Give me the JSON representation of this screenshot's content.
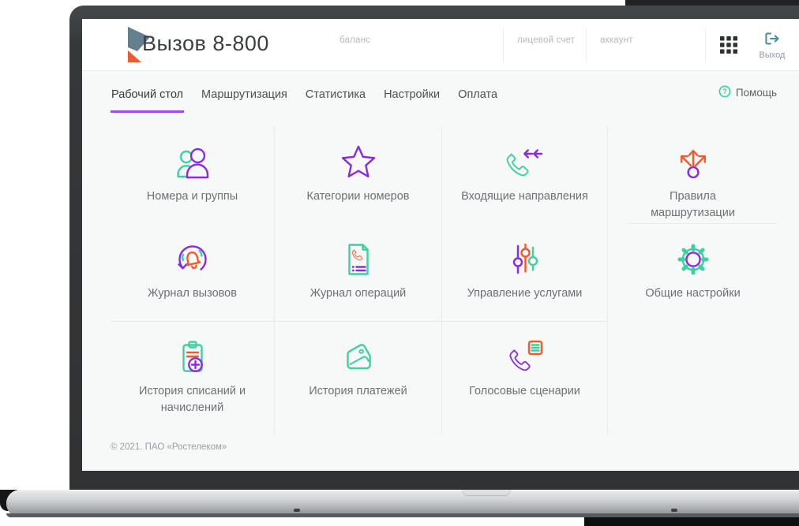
{
  "app": {
    "title": "Вызов 8-800"
  },
  "header": {
    "account_fields": [
      {
        "label": "баланс"
      },
      {
        "label": "лицевой счет"
      },
      {
        "label": "аккаунт"
      }
    ],
    "apps_icon": "apps-grid-icon",
    "logout": {
      "label": "Выход",
      "icon": "logout-icon"
    }
  },
  "nav": {
    "tabs": [
      {
        "label": "Рабочий стол",
        "active": true
      },
      {
        "label": "Маршрутизация",
        "active": false
      },
      {
        "label": "Статистика",
        "active": false
      },
      {
        "label": "Настройки",
        "active": false
      },
      {
        "label": "Оплата",
        "active": false
      }
    ],
    "help": {
      "label": "Помощь",
      "icon": "question-circle-icon"
    }
  },
  "tiles": [
    {
      "label": "Номера и группы",
      "icon": "users-icon"
    },
    {
      "label": "Категории номеров",
      "icon": "star-icon"
    },
    {
      "label": "Входящие направления",
      "icon": "incoming-call-icon"
    },
    {
      "label": "Правила маршрутизации",
      "icon": "routing-arrows-icon"
    },
    {
      "label": "Журнал вызовов",
      "icon": "call-log-bell-icon"
    },
    {
      "label": "Журнал операций",
      "icon": "operations-document-icon"
    },
    {
      "label": "Управление услугами",
      "icon": "sliders-icon"
    },
    {
      "label": "Общие настройки",
      "icon": "gear-icon"
    },
    {
      "label": "История списаний и начислений",
      "icon": "clipboard-plus-icon"
    },
    {
      "label": "История платежей",
      "icon": "wallet-icon"
    },
    {
      "label": "Голосовые сценарии",
      "icon": "voice-script-icon"
    }
  ],
  "footer": {
    "copyright": "© 2021. ПАО «Ростелеком»"
  },
  "colors": {
    "purple": "#8a2be2",
    "teal": "#3dd0a0",
    "orange": "#f05a2e",
    "underline": "#9b4dea",
    "logout": "#47899d"
  }
}
